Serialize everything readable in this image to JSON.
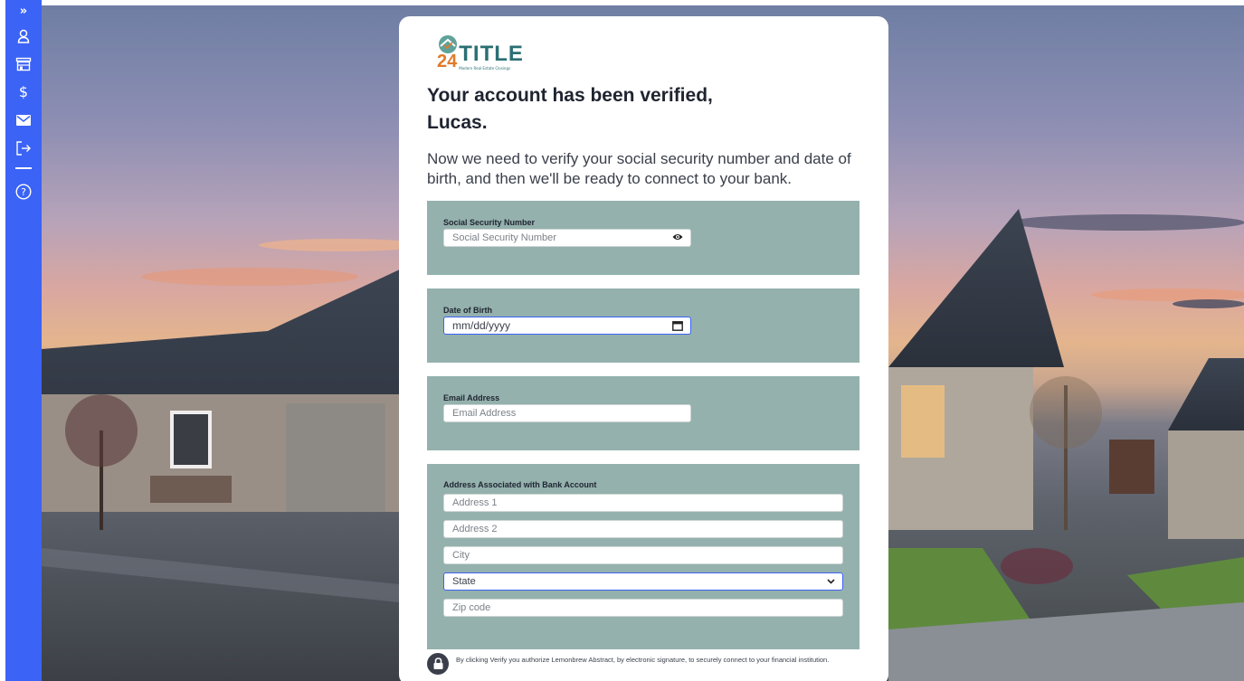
{
  "sidebar": {
    "items": [
      {
        "name": "expand-icon",
        "glyph": "»"
      },
      {
        "name": "user-icon",
        "glyph": "person"
      },
      {
        "name": "store-icon",
        "glyph": "store"
      },
      {
        "name": "dollar-icon",
        "glyph": "$"
      },
      {
        "name": "mail-icon",
        "glyph": "mail"
      },
      {
        "name": "logout-icon",
        "glyph": "logout"
      },
      {
        "name": "help-icon",
        "glyph": "?"
      }
    ],
    "color": "#3b63f5"
  },
  "logo": {
    "number": "24",
    "title": "TITLE",
    "tagline": "Modern Real Estate Closings"
  },
  "header": {
    "title_line1": "Your account has been verified,",
    "title_line2": "Lucas.",
    "subtitle": "Now we need to verify your social security number and date of birth, and then we'll be ready to connect to your bank."
  },
  "ssn": {
    "label": "Social Security Number",
    "placeholder": "Social Security Number"
  },
  "dob": {
    "label": "Date of Birth",
    "placeholder": "mm/dd/yyyy"
  },
  "email": {
    "label": "Email Address",
    "placeholder": "Email Address"
  },
  "address": {
    "label": "Address Associated with Bank Account",
    "address1_placeholder": "Address 1",
    "address2_placeholder": "Address 2",
    "city_placeholder": "City",
    "state_selected": "State",
    "zip_placeholder": "Zip code"
  },
  "consent": {
    "text": "By clicking Verify you authorize Lemonbrew Abstract, by electronic signature, to securely connect to your financial institution."
  },
  "colors": {
    "accent": "#3b63f5",
    "panel": "#94b1ad",
    "brand_orange": "#e17a2b",
    "brand_teal": "#2a6f73"
  }
}
